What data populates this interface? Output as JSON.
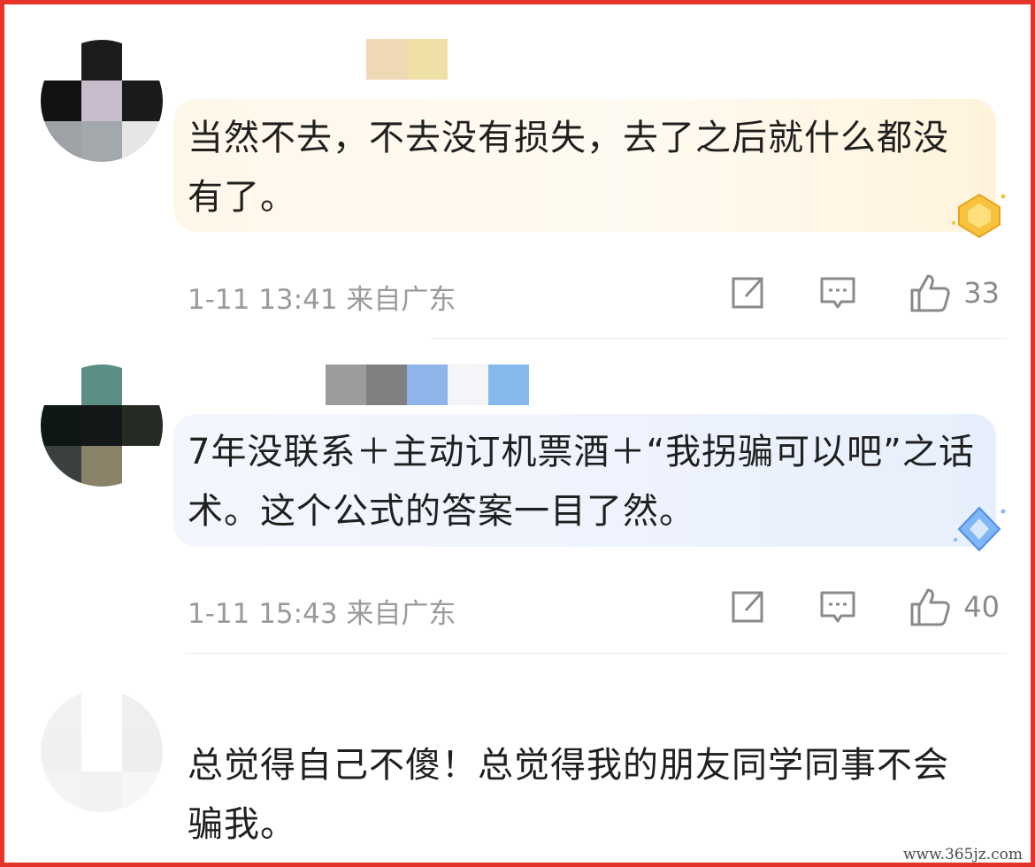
{
  "comments": [
    {
      "text": "当然不去，不去没有损失，去了之后就什么都没有了。",
      "time": "1-11 13:41",
      "location": "来自广东",
      "likes": "33",
      "badge_icon": "gold-crown-badge-icon"
    },
    {
      "text": "7年没联系＋主动订机票酒＋“我拐骗可以吧”之话术。这个公式的答案一目了然。",
      "time": "1-11 15:43",
      "location": "来自广东",
      "likes": "40",
      "badge_icon": "blue-diamond-badge-icon"
    },
    {
      "text": "总觉得自己不傻！总觉得我的朋友同学同事不会骗我。"
    }
  ],
  "icons": {
    "share": "share-icon",
    "comment": "comment-icon",
    "like": "thumbs-up-icon"
  },
  "watermark": "www.365jz.com",
  "colors": {
    "frame": "#e5332a",
    "text": "#1f1f1f",
    "meta": "#9a9a9a"
  }
}
